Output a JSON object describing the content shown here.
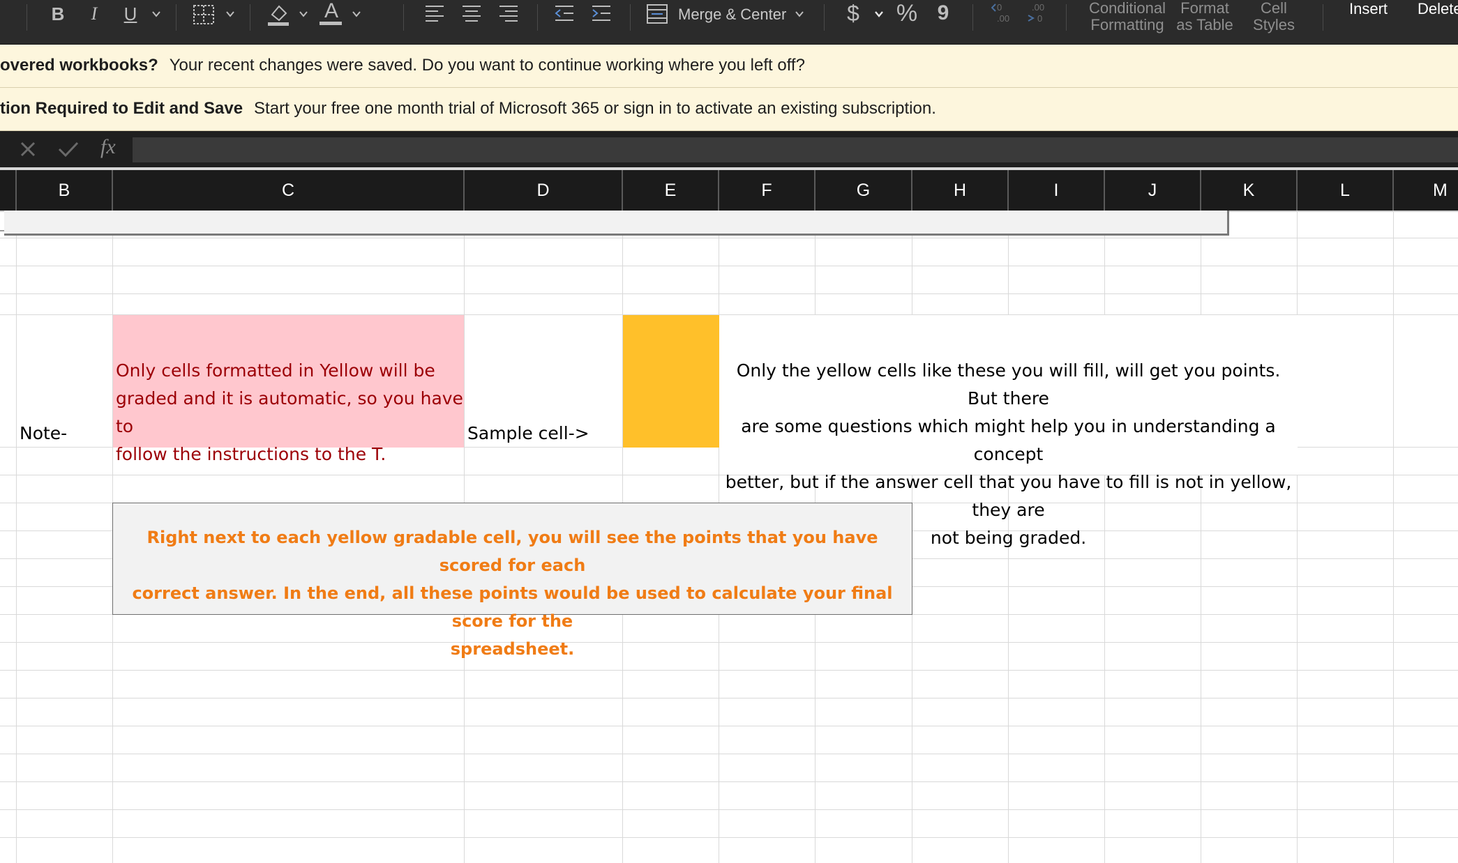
{
  "ribbon": {
    "bold": "B",
    "italic": "I",
    "underline": "U",
    "font_color_letter": "A",
    "merge_center": "Merge & Center",
    "currency": "$",
    "percent": "%",
    "comma": "9",
    "conditional_line1": "Conditional",
    "conditional_line2": "Formatting",
    "format_table_line1": "Format",
    "format_table_line2": "as Table",
    "cell_styles_line1": "Cell",
    "cell_styles_line2": "Styles",
    "insert": "Insert",
    "delete": "Delete"
  },
  "message_bars": [
    {
      "title": "overed workbooks?",
      "text": "Your recent changes were saved. Do you want to continue working where you left off?"
    },
    {
      "title": "tion Required to Edit and Save",
      "text": "Start your free one month trial of Microsoft 365 or sign in to activate an existing subscription."
    }
  ],
  "formula_bar": {
    "fx_label": "fx",
    "value": ""
  },
  "columns": [
    "B",
    "C",
    "D",
    "E",
    "F",
    "G",
    "H",
    "I",
    "J",
    "K",
    "L",
    "M"
  ],
  "cells": {
    "note_label": "Note-",
    "pink_lines": [
      "Only cells formatted in Yellow will be",
      "graded and it is automatic, so you have to",
      "follow the instructions to the T."
    ],
    "sample_label": "Sample cell->",
    "yellow_explanation_lines": [
      "Only the yellow cells like these you will fill, will get you points. But there",
      "are some questions which might help you in understanding a concept",
      "better, but if the answer cell that you have to fill is not in yellow, they are",
      "not being graded."
    ],
    "orange_box_lines": [
      "Right next to each yellow gradable cell, you will see the points that you have scored for each",
      "correct answer. In the end, all these points would be used to calculate your final score for the",
      "spreadsheet."
    ]
  },
  "colors": {
    "pink_fill": "#ffc7ce",
    "pink_text": "#9c0006",
    "yellow_fill": "#ffc02a",
    "orange_text": "#f07c15",
    "gray_box": "#f2f2f2",
    "message_bar": "#fdf6dd"
  }
}
